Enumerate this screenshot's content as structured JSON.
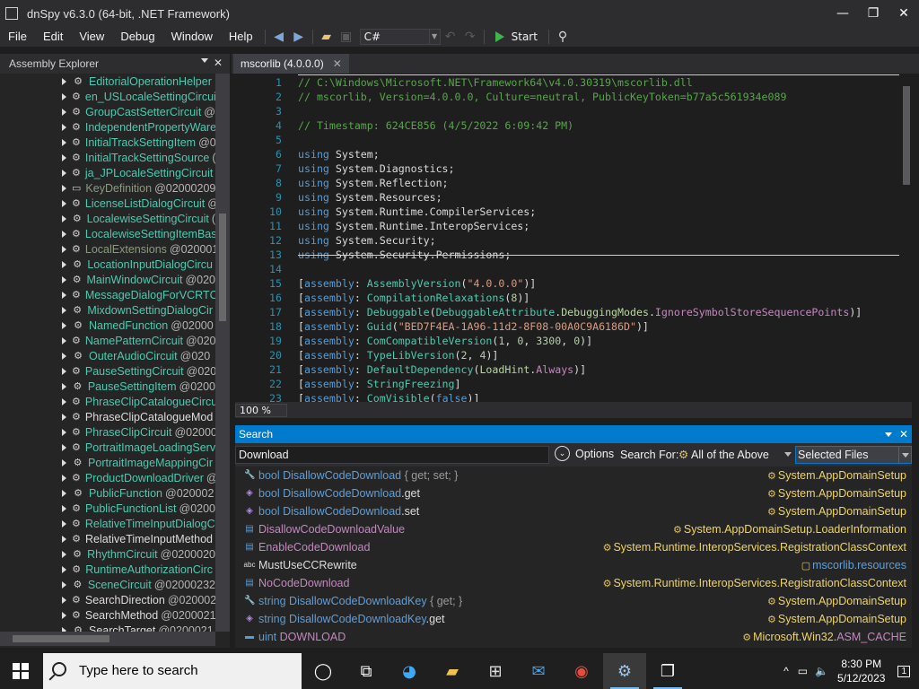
{
  "window": {
    "title": "dnSpy v6.3.0 (64-bit, .NET Framework)",
    "minimize": "—",
    "maximize": "❐",
    "close": "✕"
  },
  "menu": {
    "items": [
      "File",
      "Edit",
      "View",
      "Debug",
      "Window",
      "Help"
    ]
  },
  "toolbar": {
    "language": "C#",
    "start_label": "Start"
  },
  "explorer": {
    "title": "Assembly Explorer",
    "items": [
      {
        "name": "EditorialOperationHelper",
        "token": "",
        "kind": "class",
        "style": "type"
      },
      {
        "name": "en_USLocaleSettingCircuit",
        "token": "",
        "kind": "class",
        "style": "type"
      },
      {
        "name": "GroupCastSetterCircuit",
        "token": "@",
        "kind": "class",
        "style": "type"
      },
      {
        "name": "IndependentPropertyWare",
        "token": "",
        "kind": "class",
        "style": "type"
      },
      {
        "name": "InitialTrackSettingItem",
        "token": "@0",
        "kind": "class",
        "style": "type"
      },
      {
        "name": "InitialTrackSettingSource",
        "token": "(",
        "kind": "class",
        "style": "type"
      },
      {
        "name": "ja_JPLocaleSettingCircuit",
        "token": "",
        "kind": "class",
        "style": "type"
      },
      {
        "name": "KeyDefinition",
        "token": "@02000209",
        "kind": "struct",
        "style": "grey"
      },
      {
        "name": "LicenseListDialogCircuit",
        "token": "@",
        "kind": "class",
        "style": "type"
      },
      {
        "name": "LocalewiseSettingCircuit",
        "token": "(",
        "kind": "class",
        "style": "type"
      },
      {
        "name": "LocalewiseSettingItemBas",
        "token": "",
        "kind": "class",
        "style": "type"
      },
      {
        "name": "LocalExtensions",
        "token": "@020001",
        "kind": "class",
        "style": "grey"
      },
      {
        "name": "LocationInputDialogCircu",
        "token": "",
        "kind": "class",
        "style": "type"
      },
      {
        "name": "MainWindowCircuit",
        "token": "@020",
        "kind": "class",
        "style": "type"
      },
      {
        "name": "MessageDialogForVCRTCi",
        "token": "",
        "kind": "class",
        "style": "type"
      },
      {
        "name": "MixdownSettingDialogCir",
        "token": "",
        "kind": "class",
        "style": "type"
      },
      {
        "name": "NamedFunction",
        "token": "@02000",
        "kind": "class",
        "style": "type"
      },
      {
        "name": "NamePatternCircuit",
        "token": "@020",
        "kind": "class",
        "style": "type"
      },
      {
        "name": "OuterAudioCircuit",
        "token": "@020",
        "kind": "class",
        "style": "type"
      },
      {
        "name": "PauseSettingCircuit",
        "token": "@020",
        "kind": "class",
        "style": "type"
      },
      {
        "name": "PauseSettingItem",
        "token": "@0200",
        "kind": "class",
        "style": "type"
      },
      {
        "name": "PhraseClipCatalogueCircu",
        "token": "",
        "kind": "class",
        "style": "type"
      },
      {
        "name": "PhraseClipCatalogueMod",
        "token": "",
        "kind": "class2",
        "style": "white"
      },
      {
        "name": "PhraseClipCircuit",
        "token": "@02000",
        "kind": "class",
        "style": "type"
      },
      {
        "name": "PortraitImageLoadingServ",
        "token": "",
        "kind": "class",
        "style": "type"
      },
      {
        "name": "PortraitImageMappingCir",
        "token": "",
        "kind": "class",
        "style": "type"
      },
      {
        "name": "ProductDownloadDriver",
        "token": "@",
        "kind": "class",
        "style": "type"
      },
      {
        "name": "PublicFunction",
        "token": "@020002",
        "kind": "class",
        "style": "type"
      },
      {
        "name": "PublicFunctionList",
        "token": "@0200",
        "kind": "class",
        "style": "type"
      },
      {
        "name": "RelativeTimeInputDialogC",
        "token": "",
        "kind": "class",
        "style": "type"
      },
      {
        "name": "RelativeTimeInputMethod",
        "token": "",
        "kind": "class2",
        "style": "white"
      },
      {
        "name": "RhythmCircuit",
        "token": "@0200020",
        "kind": "class",
        "style": "type"
      },
      {
        "name": "RuntimeAuthorizationCirc",
        "token": "",
        "kind": "class",
        "style": "type"
      },
      {
        "name": "SceneCircuit",
        "token": "@02000232",
        "kind": "class",
        "style": "type"
      },
      {
        "name": "SearchDirection",
        "token": "@0200021",
        "kind": "class2",
        "style": "white"
      },
      {
        "name": "SearchMethod",
        "token": "@0200021",
        "kind": "class2",
        "style": "white"
      },
      {
        "name": "SearchTarget",
        "token": "@0200021",
        "kind": "class2",
        "style": "white"
      }
    ]
  },
  "editor": {
    "tab_label": "mscorlib (4.0.0.0)",
    "zoom": "100 %",
    "lines": [
      {
        "n": "1",
        "parts": [
          [
            "c-cmt",
            "// C:\\Windows\\Microsoft.NET\\Framework64\\v4.0.30319\\mscorlib.dll"
          ]
        ]
      },
      {
        "n": "2",
        "parts": [
          [
            "c-cmt",
            "// mscorlib, Version=4.0.0.0, Culture=neutral, PublicKeyToken=b77a5c561934e089"
          ]
        ]
      },
      {
        "n": "3",
        "parts": []
      },
      {
        "n": "4",
        "parts": [
          [
            "c-cmt",
            "// Timestamp: 624CE856 (4/5/2022 6:09:42 PM)"
          ]
        ]
      },
      {
        "n": "5",
        "parts": []
      },
      {
        "n": "6",
        "parts": [
          [
            "c-kw",
            "using "
          ],
          [
            "c-plain",
            "System;"
          ]
        ]
      },
      {
        "n": "7",
        "parts": [
          [
            "c-kw",
            "using "
          ],
          [
            "c-plain",
            "System.Diagnostics;"
          ]
        ]
      },
      {
        "n": "8",
        "parts": [
          [
            "c-kw",
            "using "
          ],
          [
            "c-plain",
            "System.Reflection;"
          ]
        ]
      },
      {
        "n": "9",
        "parts": [
          [
            "c-kw",
            "using "
          ],
          [
            "c-plain",
            "System.Resources;"
          ]
        ]
      },
      {
        "n": "10",
        "parts": [
          [
            "c-kw",
            "using "
          ],
          [
            "c-plain",
            "System.Runtime.CompilerServices;"
          ]
        ]
      },
      {
        "n": "11",
        "parts": [
          [
            "c-kw",
            "using "
          ],
          [
            "c-plain",
            "System.Runtime.InteropServices;"
          ]
        ]
      },
      {
        "n": "12",
        "parts": [
          [
            "c-kw",
            "using "
          ],
          [
            "c-plain",
            "System.Security;"
          ]
        ]
      },
      {
        "n": "13",
        "parts": [
          [
            "c-kw",
            "using "
          ],
          [
            "c-plain",
            "System.Security.Permissions;"
          ]
        ]
      },
      {
        "n": "14",
        "parts": []
      },
      {
        "n": "15",
        "parts": [
          [
            "c-plain",
            "["
          ],
          [
            "c-kw",
            "assembly"
          ],
          [
            "c-plain",
            ": "
          ],
          [
            "c-type",
            "AssemblyVersion"
          ],
          [
            "c-plain",
            "("
          ],
          [
            "c-str",
            "\"4.0.0.0\""
          ],
          [
            "c-plain",
            ")]"
          ]
        ]
      },
      {
        "n": "16",
        "parts": [
          [
            "c-plain",
            "["
          ],
          [
            "c-kw",
            "assembly"
          ],
          [
            "c-plain",
            ": "
          ],
          [
            "c-type",
            "CompilationRelaxations"
          ],
          [
            "c-plain",
            "("
          ],
          [
            "c-num",
            "8"
          ],
          [
            "c-plain",
            ")]"
          ]
        ]
      },
      {
        "n": "17",
        "parts": [
          [
            "c-plain",
            "["
          ],
          [
            "c-kw",
            "assembly"
          ],
          [
            "c-plain",
            ": "
          ],
          [
            "c-type",
            "Debuggable"
          ],
          [
            "c-plain",
            "("
          ],
          [
            "c-type",
            "DebuggableAttribute"
          ],
          [
            "c-plain",
            "."
          ],
          [
            "c-enum",
            "DebuggingModes"
          ],
          [
            "c-plain",
            "."
          ],
          [
            "c-purple",
            "IgnoreSymbolStoreSequencePoints"
          ],
          [
            "c-plain",
            ")]"
          ]
        ]
      },
      {
        "n": "18",
        "parts": [
          [
            "c-plain",
            "["
          ],
          [
            "c-kw",
            "assembly"
          ],
          [
            "c-plain",
            ": "
          ],
          [
            "c-type",
            "Guid"
          ],
          [
            "c-plain",
            "("
          ],
          [
            "c-str",
            "\"BED7F4EA-1A96-11d2-8F08-00A0C9A6186D\""
          ],
          [
            "c-plain",
            ")]"
          ]
        ]
      },
      {
        "n": "19",
        "parts": [
          [
            "c-plain",
            "["
          ],
          [
            "c-kw",
            "assembly"
          ],
          [
            "c-plain",
            ": "
          ],
          [
            "c-type",
            "ComCompatibleVersion"
          ],
          [
            "c-plain",
            "("
          ],
          [
            "c-num",
            "1"
          ],
          [
            "c-plain",
            ", "
          ],
          [
            "c-num",
            "0"
          ],
          [
            "c-plain",
            ", "
          ],
          [
            "c-num",
            "3300"
          ],
          [
            "c-plain",
            ", "
          ],
          [
            "c-num",
            "0"
          ],
          [
            "c-plain",
            ")]"
          ]
        ]
      },
      {
        "n": "20",
        "parts": [
          [
            "c-plain",
            "["
          ],
          [
            "c-kw",
            "assembly"
          ],
          [
            "c-plain",
            ": "
          ],
          [
            "c-type",
            "TypeLibVersion"
          ],
          [
            "c-plain",
            "("
          ],
          [
            "c-num",
            "2"
          ],
          [
            "c-plain",
            ", "
          ],
          [
            "c-num",
            "4"
          ],
          [
            "c-plain",
            ")]"
          ]
        ]
      },
      {
        "n": "21",
        "parts": [
          [
            "c-plain",
            "["
          ],
          [
            "c-kw",
            "assembly"
          ],
          [
            "c-plain",
            ": "
          ],
          [
            "c-type",
            "DefaultDependency"
          ],
          [
            "c-plain",
            "("
          ],
          [
            "c-enum",
            "LoadHint"
          ],
          [
            "c-plain",
            "."
          ],
          [
            "c-purple",
            "Always"
          ],
          [
            "c-plain",
            ")]"
          ]
        ]
      },
      {
        "n": "22",
        "parts": [
          [
            "c-plain",
            "["
          ],
          [
            "c-kw",
            "assembly"
          ],
          [
            "c-plain",
            ": "
          ],
          [
            "c-type",
            "StringFreezing"
          ],
          [
            "c-plain",
            "]"
          ]
        ]
      },
      {
        "n": "23",
        "parts": [
          [
            "c-plain",
            "["
          ],
          [
            "c-kw",
            "assembly"
          ],
          [
            "c-plain",
            ": "
          ],
          [
            "c-type",
            "ComVisible"
          ],
          [
            "c-plain",
            "("
          ],
          [
            "c-kw",
            "false"
          ],
          [
            "c-plain",
            ")]"
          ]
        ]
      }
    ]
  },
  "search": {
    "title": "Search",
    "query": "Download",
    "options_label": "Options",
    "search_for_label": "Search For:",
    "search_for_value": "All of the Above",
    "location_value": "Selected Files",
    "results": [
      {
        "icon": "🔧",
        "left": [
          [
            "r-kw",
            "bool "
          ],
          [
            "r-member",
            "DisallowCodeDownload"
          ],
          [
            "r-grey",
            " { get; set; }"
          ]
        ],
        "right_plain": "",
        "right_ns": "System.AppDomainSetup",
        "right_suffix": ""
      },
      {
        "icon": "◈",
        "left": [
          [
            "r-kw",
            "bool "
          ],
          [
            "r-member",
            "DisallowCodeDownload"
          ],
          [
            "r-plain",
            ".get"
          ]
        ],
        "right_plain": "",
        "right_ns": "System.AppDomainSetup",
        "right_suffix": ""
      },
      {
        "icon": "◈",
        "left": [
          [
            "r-kw",
            "bool "
          ],
          [
            "r-member",
            "DisallowCodeDownload"
          ],
          [
            "r-plain",
            ".set"
          ]
        ],
        "right_plain": "",
        "right_ns": "System.AppDomainSetup",
        "right_suffix": ""
      },
      {
        "icon": "▤",
        "left": [
          [
            "r-pink",
            "DisallowCodeDownloadValue"
          ]
        ],
        "right_plain": "",
        "right_ns": "System.AppDomainSetup",
        "right_suffix": ".LoaderInformation"
      },
      {
        "icon": "▤",
        "left": [
          [
            "r-pink",
            "EnableCodeDownload"
          ]
        ],
        "right_plain": "",
        "right_ns": "System.Runtime.InteropServices",
        "right_suffix": ".RegistrationClassContext"
      },
      {
        "icon": "abc",
        "left": [
          [
            "r-plain",
            "MustUseCCRewrite"
          ]
        ],
        "right_plain": "mscorlib.resources",
        "right_ns": "",
        "right_suffix": ""
      },
      {
        "icon": "▤",
        "left": [
          [
            "r-pink",
            "NoCodeDownload"
          ]
        ],
        "right_plain": "",
        "right_ns": "System.Runtime.InteropServices",
        "right_suffix": ".RegistrationClassContext"
      },
      {
        "icon": "🔧",
        "left": [
          [
            "r-kw",
            "string "
          ],
          [
            "r-member",
            "DisallowCodeDownloadKey"
          ],
          [
            "r-grey",
            " { get; }"
          ]
        ],
        "right_plain": "",
        "right_ns": "System.AppDomainSetup",
        "right_suffix": ""
      },
      {
        "icon": "◈",
        "left": [
          [
            "r-kw",
            "string "
          ],
          [
            "r-member",
            "DisallowCodeDownloadKey"
          ],
          [
            "r-plain",
            ".get"
          ]
        ],
        "right_plain": "",
        "right_ns": "System.AppDomainSetup",
        "right_suffix": ""
      },
      {
        "icon": "▬",
        "left": [
          [
            "r-kw",
            "uint "
          ],
          [
            "r-pink",
            "DOWNLOAD"
          ]
        ],
        "right_plain": "",
        "right_ns": "Microsoft.Win32.",
        "right_suffix": "ASM_CACHE"
      }
    ]
  },
  "taskbar": {
    "search_placeholder": "Type here to search",
    "time": "8:30 PM",
    "date": "5/12/2023",
    "notification_count": "1"
  }
}
